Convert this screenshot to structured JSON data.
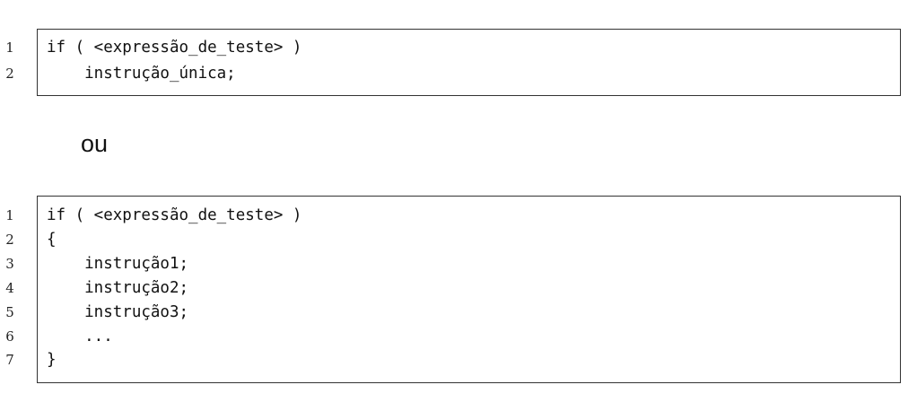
{
  "listing_1": {
    "lines": [
      {
        "number": "1",
        "code": "if ( <expressão_de_teste> )"
      },
      {
        "number": "2",
        "code": "    instrução_única;"
      }
    ]
  },
  "separator": "ou",
  "listing_2": {
    "lines": [
      {
        "number": "1",
        "code": "if ( <expressão_de_teste> )"
      },
      {
        "number": "2",
        "code": "{"
      },
      {
        "number": "3",
        "code": "    instrução1;"
      },
      {
        "number": "4",
        "code": "    instrução2;"
      },
      {
        "number": "5",
        "code": "    instrução3;"
      },
      {
        "number": "6",
        "code": "    ..."
      },
      {
        "number": "7",
        "code": "}"
      }
    ]
  }
}
